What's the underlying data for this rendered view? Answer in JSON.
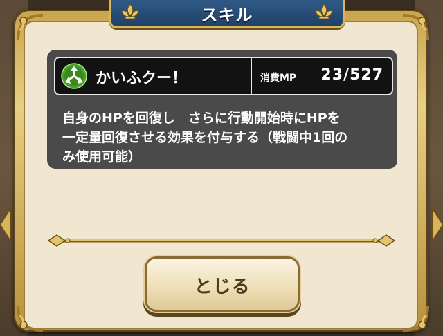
{
  "dialog": {
    "title": "スキル"
  },
  "skill": {
    "icon": "triangle-emblem-icon",
    "name": "かいふクー！",
    "mp_label": "消費MP",
    "mp_value": "23/527",
    "description_lines": [
      "自身のHPを回復し　さらに行動開始時にHPを",
      "一定量回復させる効果を付与する（戦闘中1回の",
      "み使用可能）"
    ]
  },
  "buttons": {
    "close_label": "とじる"
  },
  "colors": {
    "title_bar": "#2f5a86",
    "frame_gold": "#d9b65a",
    "panel_bg": "#f1e7d1",
    "skill_box_bg": "#4a4a4a",
    "skill_row_bg": "#121212",
    "icon_green": "#4aa329"
  }
}
